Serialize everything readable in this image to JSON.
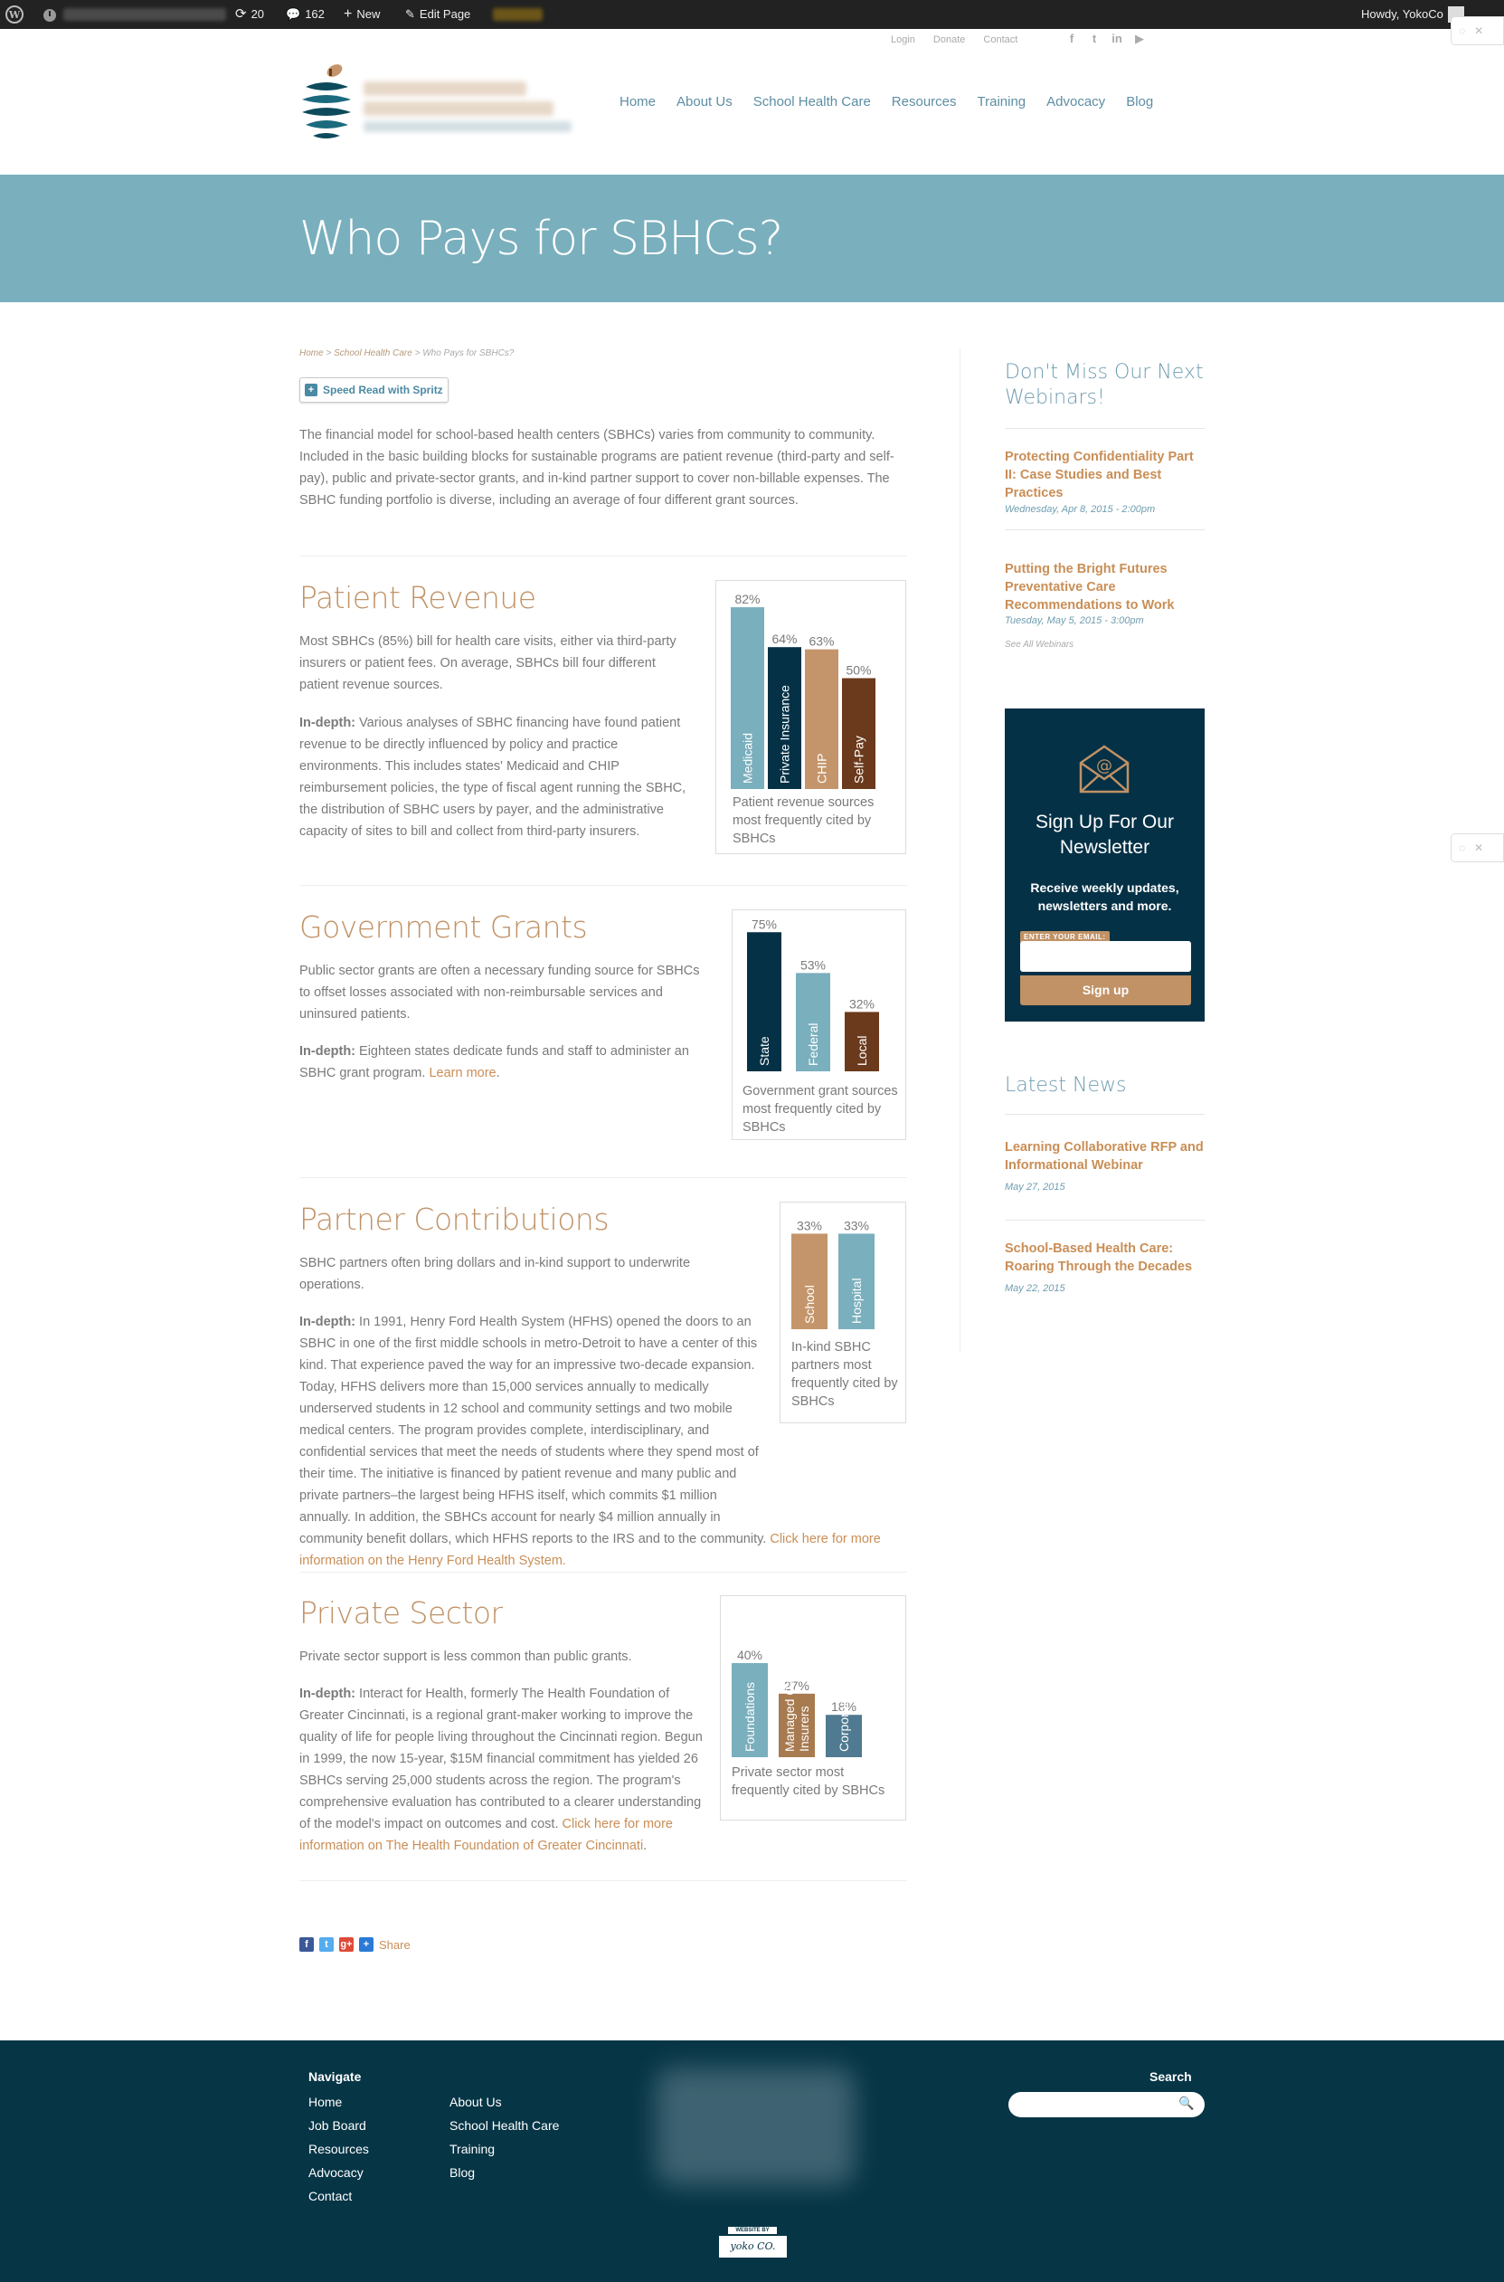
{
  "adminbar": {
    "updates": "20",
    "comments": "162",
    "new_label": "New",
    "edit_label": "Edit Page",
    "howdy": "Howdy, YokoCo"
  },
  "topnav": [
    "Login",
    "Donate",
    "Contact"
  ],
  "social_icons": [
    "facebook-icon",
    "twitter-icon",
    "linkedin-icon",
    "youtube-icon"
  ],
  "mainnav": [
    "Home",
    "About Us",
    "School Health Care",
    "Resources",
    "Training",
    "Advocacy",
    "Blog"
  ],
  "page_title": "Who Pays for SBHCs?",
  "breadcrumb": {
    "home": "Home",
    "sep1": " > ",
    "parent": "School Health Care",
    "sep2": " > ",
    "current": "Who Pays for SBHCs?"
  },
  "spritz_label": "Speed Read with Spritz",
  "intro": "The financial model for school-based health centers (SBHCs) varies from community to community. Included in the basic building blocks for sustainable programs are patient revenue (third-party and self-pay), public and private-sector grants, and in-kind partner support to cover non-billable expenses. The SBHC funding portfolio is diverse, including an average of four different grant sources.",
  "sections": {
    "patient": {
      "title": "Patient Revenue",
      "p1": "Most SBHCs (85%) bill for health care visits, either via third-party insurers or patient fees. On average, SBHCs bill four different patient revenue sources.",
      "p2_bold": "In-depth:",
      "p2": " Various analyses of SBHC financing have found patient revenue to be directly influenced by policy and practice environments. This includes states' Medicaid and CHIP reimbursement policies, the type of fiscal agent running the SBHC, the distribution of SBHC users by payer, and the administrative capacity of sites to bill and collect from third-party insurers."
    },
    "government": {
      "title": "Government Grants",
      "p1": "Public sector grants are often a necessary funding source for SBHCs to offset losses associated with non-reimbursable services and uninsured patients.",
      "p2_bold": "In-depth:",
      "p2": " Eighteen states dedicate funds and staff to administer an SBHC grant program. ",
      "p2_link": "Learn more",
      "p2_end": "."
    },
    "partner": {
      "title": "Partner Contributions",
      "p1": "SBHC partners often bring dollars and in-kind support to underwrite operations.",
      "p2_bold": "In-depth:",
      "p2": " In 1991, Henry Ford Health System (HFHS) opened the doors to an SBHC in one of the first middle schools in metro-Detroit to have a center of this kind. That experience paved the way for an impressive two-decade expansion. Today, HFHS delivers more than 15,000 services annually to medically underserved students in 12 school and community settings and two mobile medical centers. The program provides complete, interdisciplinary, and confidential services that meet the needs of students where they spend most of their time. The initiative is financed by patient revenue and many public and private partners–the largest being HFHS itself, which commits $1 million annually. In addition, the SBHCs account for nearly $4 million annually in community benefit dollars, which HFHS reports to the IRS and to the community. ",
      "p2_link": "Click here for more information on the Henry Ford Health System."
    },
    "private": {
      "title": "Private Sector",
      "p1": "Private sector support is less common than public grants.",
      "p2_bold": "In-depth:",
      "p2": " Interact for Health, formerly The Health Foundation of Greater Cincinnati, is a regional grant-maker working to improve the quality of life for people living throughout the Cincinnati region. Begun in 1999, the now 15-year, $15M financial commitment has yielded 26 SBHCs serving 25,000 students across the region. The program's comprehensive evaluation has contributed to a clearer understanding of the model's impact on outcomes and cost. ",
      "p2_link": "Click here for more information on The Health Foundation of Greater Cincinnati",
      "p2_end": "."
    }
  },
  "chart_data": [
    {
      "type": "bar",
      "categories": [
        "Medicaid",
        "Private Insurance",
        "CHIP",
        "Self-Pay"
      ],
      "values": [
        82,
        64,
        63,
        50
      ],
      "data_labels": [
        "82%",
        "64%",
        "63%",
        "50%"
      ],
      "colors": [
        "#7aafbd",
        "#053146",
        "#c4956a",
        "#6b3a1c"
      ],
      "caption": "Patient revenue sources most frequently cited by SBHCs",
      "ylim": [
        0,
        100
      ]
    },
    {
      "type": "bar",
      "categories": [
        "State",
        "Federal",
        "Local"
      ],
      "values": [
        75,
        53,
        32
      ],
      "data_labels": [
        "75%",
        "53%",
        "32%"
      ],
      "colors": [
        "#053146",
        "#7aafbd",
        "#6b3a1c"
      ],
      "caption": "Government grant sources most frequently cited by SBHCs",
      "ylim": [
        0,
        100
      ]
    },
    {
      "type": "bar",
      "categories": [
        "School",
        "Hospital"
      ],
      "values": [
        33,
        33
      ],
      "data_labels": [
        "33%",
        "33%"
      ],
      "colors": [
        "#c4956a",
        "#7aafbd"
      ],
      "caption": "In-kind SBHC partners most frequently cited by SBHCs",
      "ylim": [
        0,
        100
      ]
    },
    {
      "type": "bar",
      "categories": [
        "Foundations",
        "Managed Care/ Insurers",
        "Corporations"
      ],
      "values": [
        40,
        27,
        18
      ],
      "data_labels": [
        "40%",
        "27%",
        "18%"
      ],
      "colors": [
        "#7aafbd",
        "#a77a4f",
        "#4f7a91"
      ],
      "caption": "Private sector most frequently cited by SBHCs",
      "ylim": [
        0,
        100
      ]
    }
  ],
  "share_label": "Share",
  "sidebar": {
    "webinars_title": "Don't Miss Our Next Webinars!",
    "webinars": [
      {
        "title": "Protecting Confidentiality Part II: Case Studies and Best Practices",
        "date": "Wednesday, Apr 8, 2015 - 2:00pm"
      },
      {
        "title": "Putting the Bright Futures Preventative Care Recommendations to Work",
        "date": "Tuesday, May 5, 2015 - 3:00pm"
      }
    ],
    "see_all": "See All Webinars",
    "newsletter": {
      "title": "Sign Up For Our Newsletter",
      "desc": "Receive weekly updates, newsletters and more.",
      "email_label": "ENTER YOUR EMAIL:",
      "button": "Sign up"
    },
    "news_title": "Latest News",
    "news": [
      {
        "title": "Learning Collaborative RFP and Informational Webinar",
        "date": "May 27, 2015"
      },
      {
        "title": "School-Based Health Care: Roaring Through the Decades",
        "date": "May 22, 2015"
      }
    ]
  },
  "footer": {
    "navigate_title": "Navigate",
    "col1": [
      "Home",
      "Job Board",
      "Resources",
      "Advocacy",
      "Contact"
    ],
    "col2": [
      "About Us",
      "School Health Care",
      "Training",
      "Blog"
    ],
    "search_title": "Search",
    "credit_top": "WEBSITE BY",
    "credit_brand": "yoko CO."
  },
  "colors": {
    "accent": "#c98e56",
    "teal": "#7aafbd",
    "navy": "#053146",
    "brown": "#6b3a1c"
  }
}
